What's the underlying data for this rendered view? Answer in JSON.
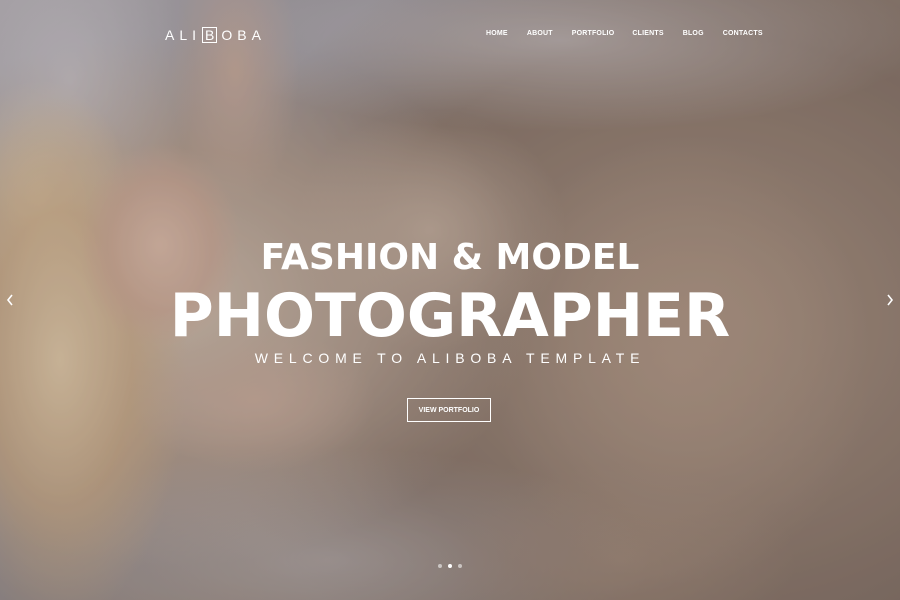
{
  "logo": {
    "before": "ALI",
    "boxed": "B",
    "after": "OBA"
  },
  "nav": {
    "items": [
      "HOME",
      "ABOUT",
      "PORTFOLIO",
      "CLIENTS",
      "BLOG",
      "CONTACTS"
    ]
  },
  "hero": {
    "title_line1": "FASHION & MODEL",
    "title_line2": "PHOTOGRAPHER",
    "subtitle": "WELCOME TO ALIBOBA TEMPLATE",
    "cta_label": "VIEW PORTFOLIO"
  },
  "slider": {
    "arrow_left_icon": "chevron-left-icon",
    "arrow_right_icon": "chevron-right-icon",
    "slide_count": 3,
    "active_slide": 2
  },
  "colors": {
    "text": "#ffffff",
    "overlay": "rgba(35,30,35,0.18)"
  }
}
